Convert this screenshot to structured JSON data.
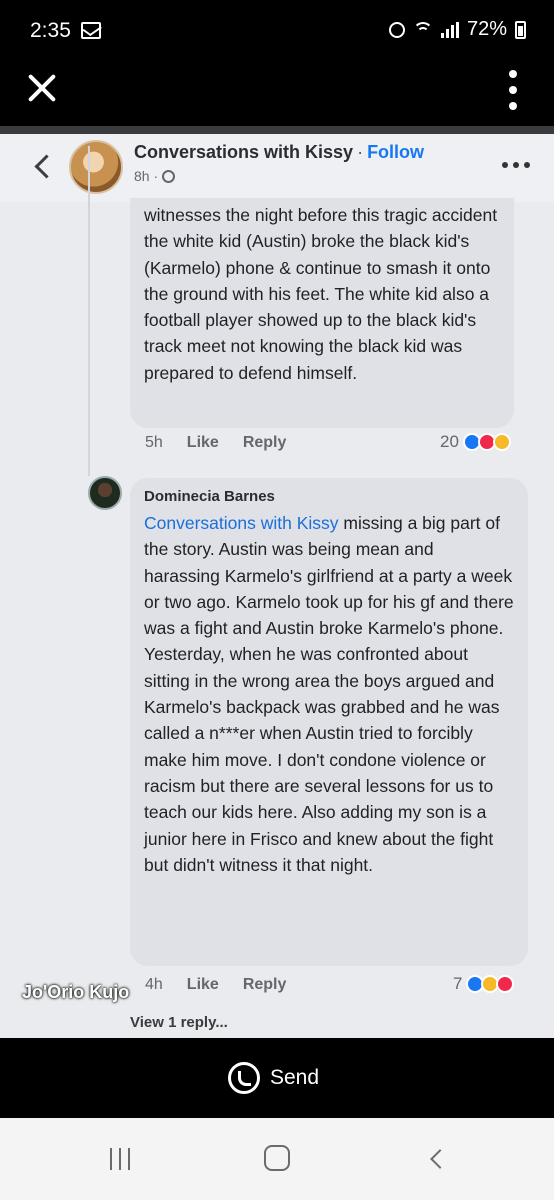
{
  "status_bar": {
    "time": "2:35",
    "battery": "72%"
  },
  "post": {
    "page_name": "Conversations with Kissy",
    "separator": "·",
    "follow_label": "Follow",
    "time": "8h ·"
  },
  "comment1": {
    "text": "witnesses the night before this tragic accident the white kid (Austin) broke the black kid's (Karmelo) phone & continue to smash it onto the ground with his feet. The white kid also a football player showed up to the black kid's track meet not knowing the black kid was prepared to defend himself.",
    "time": "5h",
    "like_label": "Like",
    "reply_label": "Reply",
    "reaction_count": "20"
  },
  "comment2": {
    "author": "Dominecia Barnes",
    "mention": "Conversations with Kissy",
    "text": " missing a big part of the story. Austin was being mean and harassing Karmelo's girlfriend at a party a week or two ago. Karmelo took up for his gf and there was a fight and Austin broke Karmelo's phone. Yesterday, when he was confronted about sitting in the wrong area the boys argued and Karmelo's backpack was grabbed and he was called a n***er when Austin tried to forcibly make him move. I don't condone violence or racism but there are several lessons for us to teach our kids here. Also adding my son is a junior here in Frisco and knew about the fight but didn't witness it that night.",
    "time": "4h",
    "like_label": "Like",
    "reply_label": "Reply",
    "reaction_count": "7",
    "view_replies": "View 1 reply..."
  },
  "watermark": "Jo'Orio Kujo",
  "send_label": "Send"
}
